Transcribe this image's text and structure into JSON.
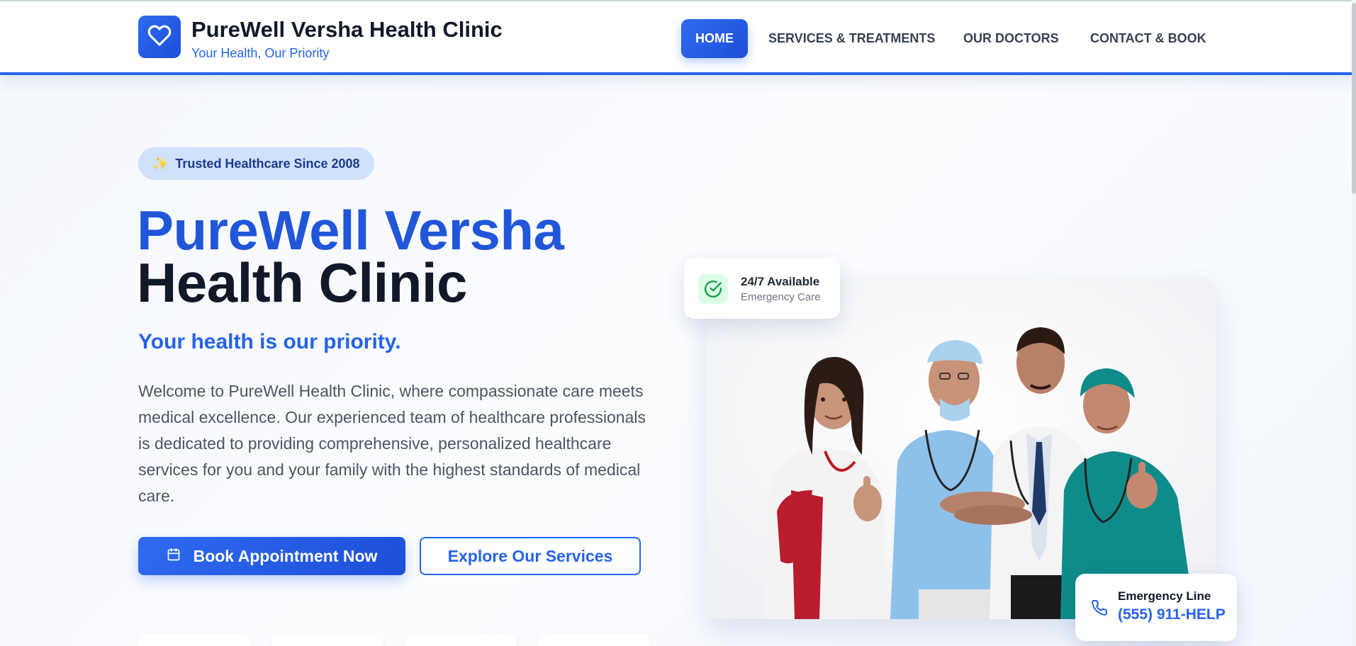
{
  "header": {
    "brand_name": "PureWell Versha Health Clinic",
    "brand_tagline": "Your Health, Our Priority",
    "logo_icon": "heart-icon",
    "nav": [
      {
        "label": "HOME",
        "active": true
      },
      {
        "label": "SERVICES & TREATMENTS",
        "active": false
      },
      {
        "label": "OUR DOCTORS",
        "active": false
      },
      {
        "label": "CONTACT & BOOK",
        "active": false
      }
    ]
  },
  "hero": {
    "badge_icon": "sparkle-icon",
    "badge_text": "Trusted Healthcare Since 2008",
    "title_line_1": "PureWell Versha",
    "title_line_2": "Health Clinic",
    "subtitle": "Your health is our priority.",
    "description": "Welcome to PureWell Health Clinic, where compassionate care meets medical excellence. Our experienced team of healthcare professionals is dedicated to providing comprehensive, personalized healthcare services for you and your family with the highest standards of medical care.",
    "primary_button": {
      "icon": "calendar-icon",
      "label": "Book Appointment Now"
    },
    "secondary_button": {
      "label": "Explore Our Services"
    }
  },
  "availability_card": {
    "icon": "check-circle-icon",
    "title": "24/7 Available",
    "subtitle": "Emergency Care"
  },
  "emergency_card": {
    "icon": "phone-icon",
    "title": "Emergency Line",
    "phone": "(555) 911-HELP"
  },
  "colors": {
    "primary": "#2563eb",
    "primary_dark": "#1d4ed8",
    "heading_dark": "#111827",
    "badge_bg": "#cfe1fb",
    "success_bg": "#dcfce7",
    "success": "#16a34a"
  }
}
